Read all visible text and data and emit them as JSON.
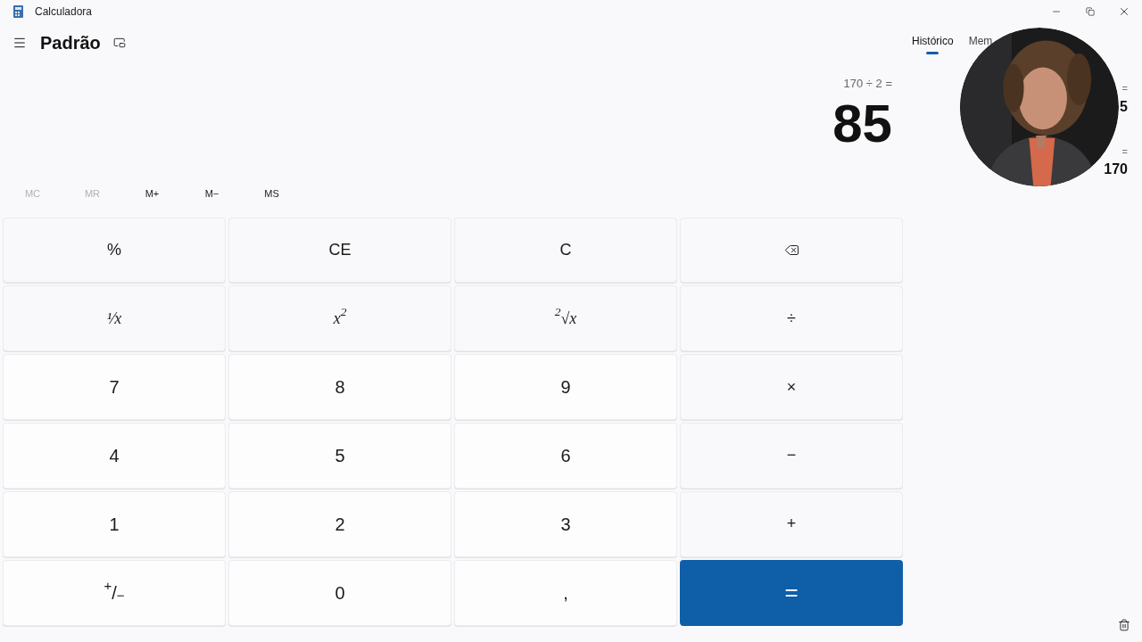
{
  "window": {
    "title": "Calculadora"
  },
  "header": {
    "mode": "Padrão"
  },
  "display": {
    "expression": "170 ÷ 2 =",
    "result": "85"
  },
  "memory": [
    {
      "label": "MC",
      "disabled": true
    },
    {
      "label": "MR",
      "disabled": true
    },
    {
      "label": "M+",
      "disabled": false
    },
    {
      "label": "M−",
      "disabled": false
    },
    {
      "label": "MS",
      "disabled": false
    }
  ],
  "keys": [
    {
      "kind": "function",
      "label": "%"
    },
    {
      "kind": "function",
      "label": "CE"
    },
    {
      "kind": "function",
      "label": "C"
    },
    {
      "kind": "backspace"
    },
    {
      "kind": "math",
      "label": "¹⁄x"
    },
    {
      "kind": "math",
      "label": "x$^{2}$"
    },
    {
      "kind": "math",
      "label": "$^{2}$√x"
    },
    {
      "kind": "function",
      "label": "÷"
    },
    {
      "kind": "digit",
      "label": "7"
    },
    {
      "kind": "digit",
      "label": "8"
    },
    {
      "kind": "digit",
      "label": "9"
    },
    {
      "kind": "function",
      "label": "×"
    },
    {
      "kind": "digit",
      "label": "4"
    },
    {
      "kind": "digit",
      "label": "5"
    },
    {
      "kind": "digit",
      "label": "6"
    },
    {
      "kind": "function",
      "label": "−"
    },
    {
      "kind": "digit",
      "label": "1"
    },
    {
      "kind": "digit",
      "label": "2"
    },
    {
      "kind": "digit",
      "label": "3"
    },
    {
      "kind": "function",
      "label": "+"
    },
    {
      "kind": "digit",
      "label": "$^{+}$/$_{−}$"
    },
    {
      "kind": "digit",
      "label": "0"
    },
    {
      "kind": "digit",
      "label": ","
    },
    {
      "kind": "equals",
      "label": "="
    }
  ],
  "side_tabs": [
    {
      "label": "Histórico",
      "selected": true
    },
    {
      "label": "Mem",
      "selected": false
    }
  ],
  "history": [
    {
      "expression": "=",
      "result": "5"
    },
    {
      "expression": "=",
      "result": "170"
    }
  ]
}
